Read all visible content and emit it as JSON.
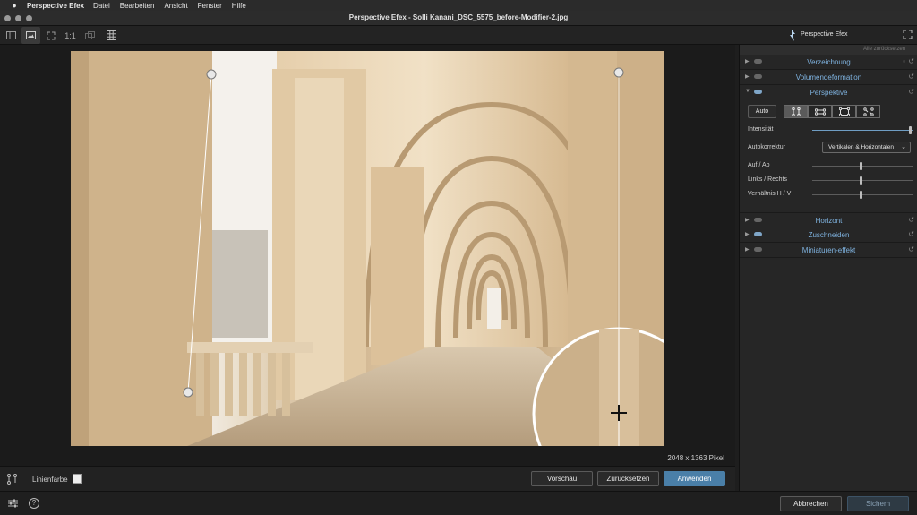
{
  "menubar": {
    "app_name": "Perspective Efex",
    "items": [
      "Datei",
      "Bearbeiten",
      "Ansicht",
      "Fenster",
      "Hilfe"
    ]
  },
  "window": {
    "title": "Perspective Efex - Solli Kanani_DSC_5575_before-Modifier-2.jpg"
  },
  "toolbar": {
    "zoom_label": "1:1"
  },
  "brand": {
    "name": "Perspective Efex"
  },
  "canvas": {
    "pixel_info": "2048 x 1363 Pixel"
  },
  "bottom": {
    "line_color_label": "Linienfarbe",
    "preview_label": "Vorschau",
    "reset_label": "Zurücksetzen",
    "apply_label": "Anwenden"
  },
  "footer": {
    "cancel_label": "Abbrechen",
    "save_label": "Sichern"
  },
  "panel": {
    "reset_all": "Alle zurücksetzen",
    "sections": {
      "verzeichnung": "Verzeichnung",
      "volumen": "Volumendeformation",
      "perspektive": "Perspektive",
      "horizont": "Horizont",
      "zuschneiden": "Zuschneiden",
      "miniatur": "Miniaturen-effekt"
    },
    "auto_label": "Auto",
    "intensity_label": "Intensität",
    "intensity_value": 1.0,
    "autokorrektur_label": "Autokorrektur",
    "autokorrektur_value": "Vertikalen & Horizontalen",
    "up_down_label": "Auf / Ab",
    "up_down_value": 0.5,
    "left_right_label": "Links / Rechts",
    "left_right_value": 0.5,
    "ratio_label": "Verhältnis H / V",
    "ratio_value": 0.5
  },
  "colors": {
    "accent": "#4a7fa8",
    "section_title": "#7fb3e0"
  }
}
